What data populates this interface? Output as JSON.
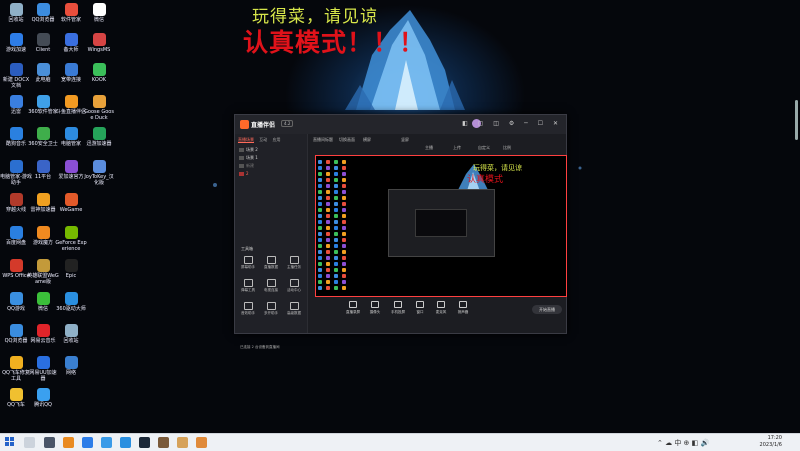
{
  "wallpaper": {
    "title": "玩得菜，请见谅",
    "subtitle": "认真模式！！！"
  },
  "desktop_icons": [
    {
      "label": "回收站",
      "color": "#8fb0c7"
    },
    {
      "label": "QQ浏览器",
      "color": "#3c8de0"
    },
    {
      "label": "软件管家",
      "color": "#e94e3c"
    },
    {
      "label": "微信",
      "color": "#ffffff"
    },
    {
      "label": "游戏加速",
      "color": "#2d7de8"
    },
    {
      "label": "Client",
      "color": "#444b55"
    },
    {
      "label": "备大师",
      "color": "#3a6fe0"
    },
    {
      "label": "WingsMS",
      "color": "#d64444"
    },
    {
      "label": "新建 DOCX 文档",
      "color": "#2b5dbf"
    },
    {
      "label": "此电脑",
      "color": "#4a8fd8"
    },
    {
      "label": "宽带连接",
      "color": "#3a7bd5"
    },
    {
      "label": "KOOK",
      "color": "#3bbf5a"
    },
    {
      "label": "迅雷",
      "color": "#3a7fe0"
    },
    {
      "label": "360软件管家",
      "color": "#3fa0e8"
    },
    {
      "label": "斗鱼直播伴侣",
      "color": "#f29a22"
    },
    {
      "label": "Goose Goose Duck",
      "color": "#e8a13a"
    },
    {
      "label": "酷狗音乐",
      "color": "#2a80e0"
    },
    {
      "label": "360安全卫士",
      "color": "#3fae4b"
    },
    {
      "label": "电脑管家",
      "color": "#2d8be0"
    },
    {
      "label": "迅游加速器",
      "color": "#25a35a"
    },
    {
      "label": "电脑管家-游戏助手",
      "color": "#2b6fd0"
    },
    {
      "label": "11平台",
      "color": "#3a64c7"
    },
    {
      "label": "爱加速官方",
      "color": "#8a4fd4"
    },
    {
      "label": "JoyToKey_汉化版",
      "color": "#5b8dde"
    },
    {
      "label": "穿越火线",
      "color": "#b23a2a"
    },
    {
      "label": "雷神加速器",
      "color": "#f0a020"
    },
    {
      "label": "WeGame",
      "color": "#e35a2a"
    },
    {
      "label": "百度网盘",
      "color": "#2a7fe0"
    },
    {
      "label": "游戏魔方",
      "color": "#f08a20"
    },
    {
      "label": "GeForce Experience",
      "color": "#76b900"
    },
    {
      "label": "WPS Office",
      "color": "#d43a2a"
    },
    {
      "label": "英雄联盟WeGame版",
      "color": "#c39a3a"
    },
    {
      "label": "Epic",
      "color": "#222"
    },
    {
      "label": "QQ游戏",
      "color": "#3a8fe0"
    },
    {
      "label": "微信",
      "color": "#3bbf3a"
    },
    {
      "label": "360驱动大师",
      "color": "#2a8fe0"
    },
    {
      "label": "QQ浏览器",
      "color": "#3a8de0"
    },
    {
      "label": "网易云音乐",
      "color": "#e0242a"
    },
    {
      "label": "回收站",
      "color": "#8fb0c7"
    },
    {
      "label": "QQ飞车修复工具",
      "color": "#f0b020"
    },
    {
      "label": "网易UU加速器",
      "color": "#2a6fe0"
    },
    {
      "label": "网络",
      "color": "#3a7fd0"
    },
    {
      "label": "QQ飞车",
      "color": "#f0c030"
    },
    {
      "label": "腾讯QQ",
      "color": "#3aa0f0"
    }
  ],
  "app": {
    "title": "直播伴侣",
    "badge": "4.2",
    "window_controls": "◧ ▢ ◫ ⚙ ─ ☐ ✕",
    "side_tabs": [
      {
        "label": "直播场景",
        "active": true
      },
      {
        "label": "互动"
      },
      {
        "label": "应用"
      }
    ],
    "scenes": [
      "场景 2",
      "场景 1",
      "新建",
      "2"
    ],
    "tools_title": "工具箱",
    "tools": [
      "屏幕助手",
      "直播数据",
      "主播任务",
      "弹幕工具",
      "电视连接",
      "活动中心",
      "音效助手",
      "多开助手",
      "高级数据"
    ],
    "status": "已连接 2 台设备到直播间",
    "topbar_items": [
      "直播间标题",
      "切换画面",
      "横屏",
      "",
      "竖屏",
      "主播",
      "上传",
      "自定义",
      "比例"
    ],
    "preview_title": "玩得菜，请见谅",
    "preview_subtitle": "认真模式",
    "controls": [
      "直播录屏",
      "摄像头",
      "手机投屏",
      "窗口",
      "麦克风",
      "扬声器"
    ],
    "live_button": "开始直播"
  },
  "taskbar": {
    "tray": "⌃ ☁ 中 ⊕ ◧ 🔊",
    "time": "17:20",
    "date": "2023/1/6"
  }
}
